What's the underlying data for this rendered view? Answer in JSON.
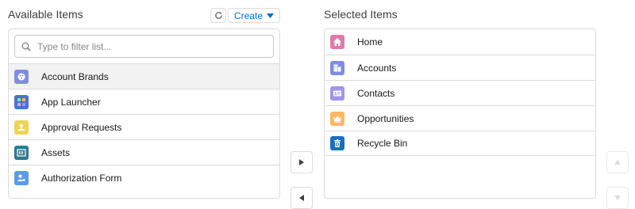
{
  "available": {
    "title": "Available Items",
    "create_label": "Create",
    "search_placeholder": "Type to filter list...",
    "items": [
      {
        "label": "Account Brands",
        "icon": "account-brands-icon",
        "color": "#7f8de1"
      },
      {
        "label": "App Launcher",
        "icon": "app-launcher-icon",
        "color": "#4b6fd8"
      },
      {
        "label": "Approval Requests",
        "icon": "approval-icon",
        "color": "#ecd45a"
      },
      {
        "label": "Assets",
        "icon": "assets-icon",
        "color": "#317992"
      },
      {
        "label": "Authorization Form",
        "icon": "authorization-form-icon",
        "color": "#5a9be6"
      }
    ]
  },
  "selected": {
    "title": "Selected Items",
    "items": [
      {
        "label": "Home",
        "icon": "home-icon",
        "color": "#e07aa9"
      },
      {
        "label": "Accounts",
        "icon": "accounts-icon",
        "color": "#7f8de1"
      },
      {
        "label": "Contacts",
        "icon": "contacts-icon",
        "color": "#a094ed"
      },
      {
        "label": "Opportunities",
        "icon": "opportunities-icon",
        "color": "#fcb95b"
      },
      {
        "label": "Recycle Bin",
        "icon": "recycle-bin-icon",
        "color": "#1b6ec2"
      }
    ]
  },
  "colors": {
    "accent": "#0070d2",
    "border": "#dddbda"
  }
}
